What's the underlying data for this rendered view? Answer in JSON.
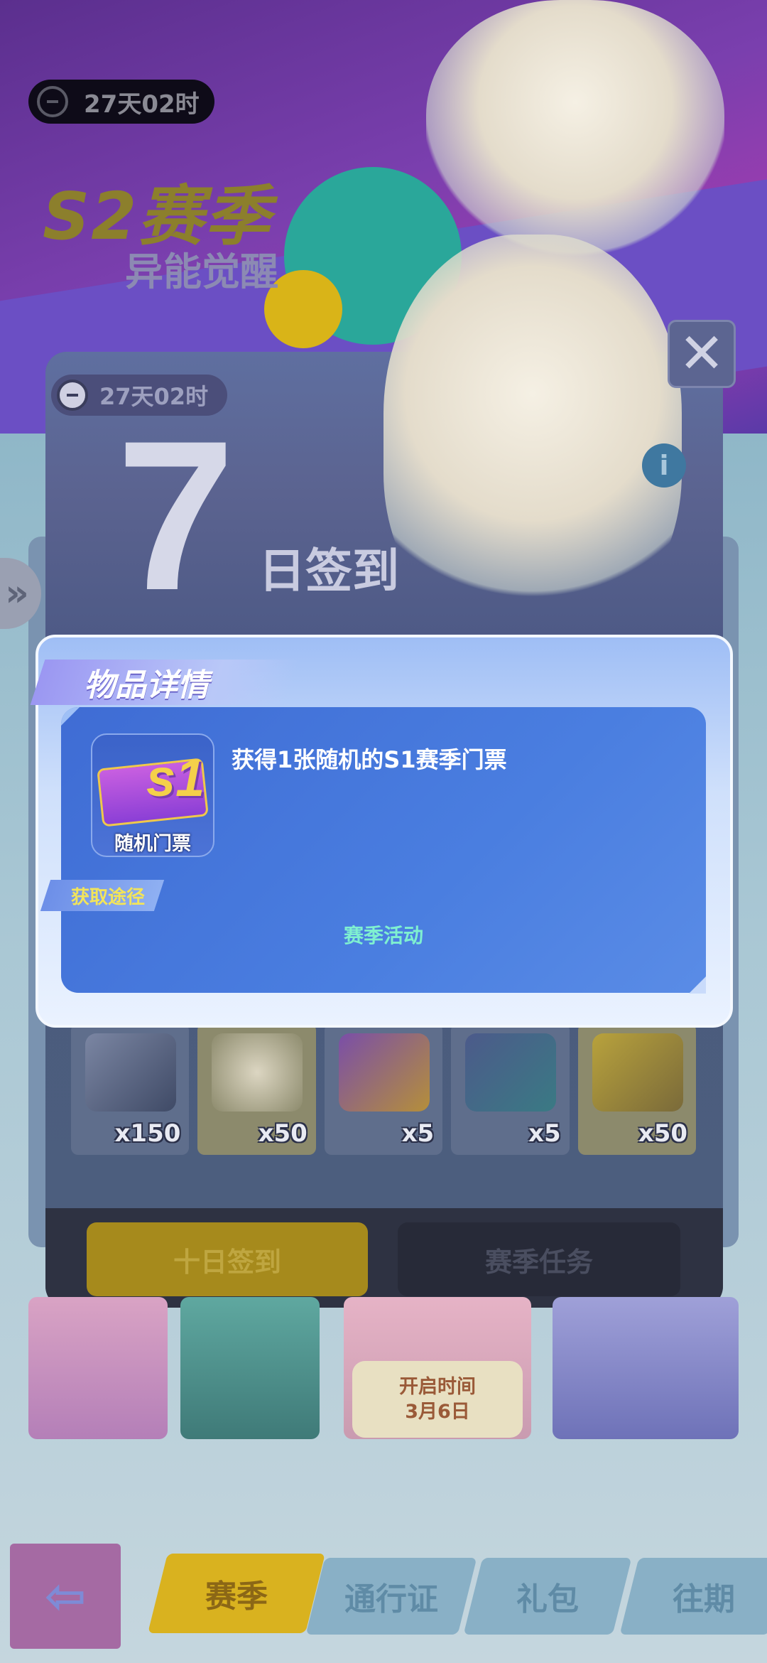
{
  "header": {
    "timer": "27天02时",
    "season_title": "S2赛季",
    "season_subtitle": "异能觉醒"
  },
  "signin_panel": {
    "timer": "27天02时",
    "big_number": "7",
    "title": "日签到",
    "close_icon": "close-icon",
    "info_icon": "info-icon",
    "rewards": [
      {
        "icon": "shield-token-icon",
        "qty": "x150",
        "bg": "#5f6e8c"
      },
      {
        "icon": "character-avatar-icon",
        "qty": "x50",
        "bg": "#8c8a6c"
      },
      {
        "icon": "s1-ticket-icon",
        "qty": "x5",
        "bg": "#5f6e8c"
      },
      {
        "icon": "mystery-crystal-icon",
        "qty": "x5",
        "bg": "#5f6e8c"
      },
      {
        "icon": "gold-ticket-icon",
        "qty": "x50",
        "bg": "#8c8a6c"
      }
    ],
    "tabs": [
      "十日签到",
      "赛季任务"
    ]
  },
  "activity_cards": {
    "open_time_label": "开启时间",
    "open_time_date": "3月6日"
  },
  "bottom_nav": {
    "back_icon": "back-arrow-icon",
    "tabs": [
      "赛季",
      "通行证",
      "礼包",
      "往期"
    ]
  },
  "item_detail": {
    "title": "物品详情",
    "item_name": "随机门票",
    "item_badge": "s1",
    "description": "获得1张随机的S1赛季门票",
    "source_label": "获取途径",
    "source_value": "赛季活动"
  },
  "colors": {
    "accent_yellow": "#d9b21f",
    "modal_blue": "#3f6cd4",
    "source_text": "#7ff0d0",
    "source_label_text": "#f2e45a"
  }
}
